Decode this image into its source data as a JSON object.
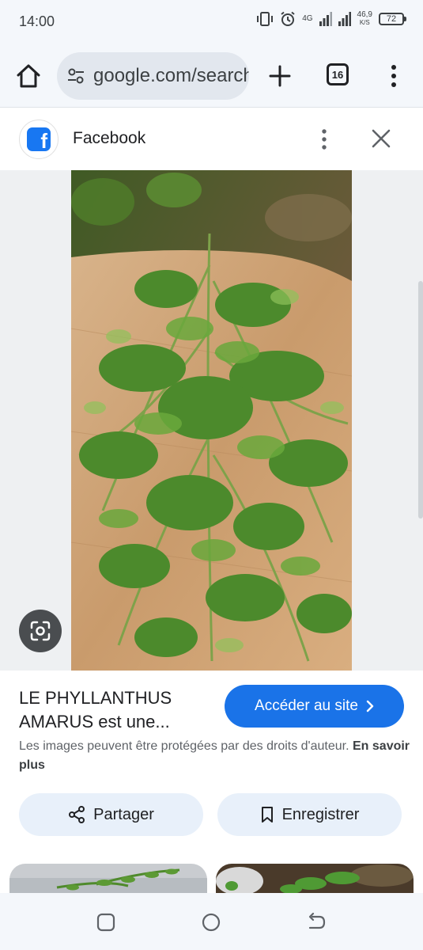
{
  "status_bar": {
    "time": "14:00",
    "network_label": "4G",
    "speed_value": "46,9",
    "speed_unit": "K/S",
    "battery": "72"
  },
  "browser": {
    "url": "google.com/search",
    "tab_count": "16"
  },
  "source": {
    "name": "Facebook",
    "brand_color": "#1877f2"
  },
  "result": {
    "title": "LE PHYLLANTHUS AMARUS est une...",
    "visit_label": "Accéder au site",
    "copyright_text": "Les images peuvent être protégées par des droits d'auteur.",
    "learn_more": "En savoir plus",
    "share_label": "Partager",
    "save_label": "Enregistrer",
    "accent_color": "#1a73e8"
  },
  "icons": {
    "home": "home-icon",
    "tune": "tune-icon",
    "new_tab": "plus-icon",
    "tabs": "tabs-icon",
    "menu": "more-vert-icon",
    "close": "close-icon",
    "lens": "lens-icon",
    "share": "share-icon",
    "bookmark": "bookmark-icon",
    "chevron": "chevron-right-icon"
  }
}
